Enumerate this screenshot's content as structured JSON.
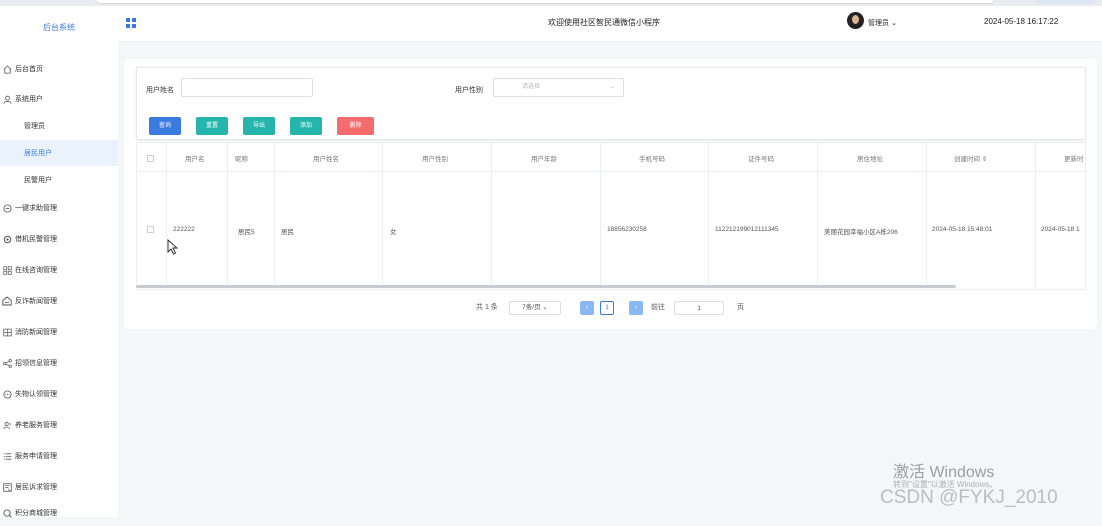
{
  "app": {
    "brand": "后台系统",
    "welcome": "欢迎使用社区智民通微信小程序",
    "admin_label": "管理员",
    "datetime": "2024-05-18 16:17:22"
  },
  "sidebar": {
    "items": [
      {
        "label": "后台首页",
        "icon": "home-icon"
      },
      {
        "label": "系统用户",
        "icon": "user-icon"
      },
      {
        "label": "管理员",
        "sub": true
      },
      {
        "label": "居民用户",
        "sub": true,
        "active": true
      },
      {
        "label": "民警用户",
        "sub": true
      },
      {
        "label": "一键求助管理",
        "icon": "help-icon"
      },
      {
        "label": "借机民警管理",
        "icon": "gear-icon"
      },
      {
        "label": "在线咨询管理",
        "icon": "grid-icon"
      },
      {
        "label": "反诈新闻管理",
        "icon": "house-icon"
      },
      {
        "label": "消防新闻管理",
        "icon": "news-icon"
      },
      {
        "label": "招领信息管理",
        "icon": "share-icon"
      },
      {
        "label": "失物认领管理",
        "icon": "chat-icon"
      },
      {
        "label": "养老服务管理",
        "icon": "people-icon"
      },
      {
        "label": "服务申请管理",
        "icon": "list-icon"
      },
      {
        "label": "居民诉求管理",
        "icon": "doc-icon"
      },
      {
        "label": "积分商城管理",
        "icon": "cart-icon"
      }
    ]
  },
  "search": {
    "name_label": "用户姓名",
    "name_value": "",
    "gender_label": "用户性别",
    "gender_placeholder": "请选择",
    "buttons": {
      "query": "查询",
      "reset": "重置",
      "export": "导出",
      "add": "添加",
      "delete": "删除"
    }
  },
  "table": {
    "headers": [
      "用户名",
      "昵称",
      "用户姓名",
      "用户性别",
      "用户年龄",
      "手机号码",
      "证件号码",
      "居住地址",
      "创建时间 ⇕",
      "更新时"
    ],
    "rows": [
      [
        "222222",
        "居民5",
        "居民",
        "女",
        "",
        "18856230258",
        "112212199012111345",
        "美丽花园幸福小区A栋206",
        "2024-05-18 15:48:01",
        "2024-05-18 1"
      ]
    ]
  },
  "pagination": {
    "total": "共 1 条",
    "page_size": "7条/页",
    "current": "1",
    "goto_label": "前往",
    "goto_value": "1",
    "page_suffix": "页"
  },
  "overlay": {
    "activate_title": "激活 Windows",
    "activate_sub": "转到\"设置\"以激活 Windows。",
    "csdn": "CSDN @FYKJ_2010"
  },
  "colors": {
    "query": "#3a7be0",
    "reset": "#26b5ad",
    "export": "#26b5ad",
    "add": "#26b5ad",
    "delete": "#f56c6c",
    "accent": "#3a7be0"
  }
}
